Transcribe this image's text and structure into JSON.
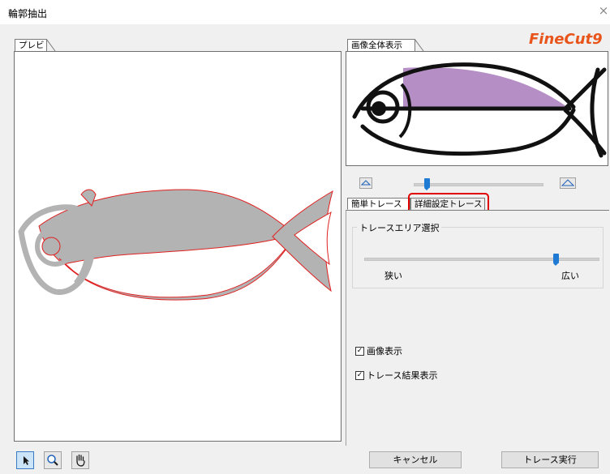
{
  "window": {
    "title": "輪郭抽出",
    "close_glyph": "×"
  },
  "preview": {
    "tab_label": "プレビュー"
  },
  "overview": {
    "tab_label": "画像全体表示",
    "brand": "FineCut9",
    "zoom_level": 0.1
  },
  "trace_tabs": [
    {
      "label": "簡単トレース",
      "active": true
    },
    {
      "label": "詳細設定トレース",
      "active": false,
      "highlighted": true
    }
  ],
  "trace_area": {
    "group_label": "トレースエリア選択",
    "min_label": "狭い",
    "max_label": "広い",
    "value": 0.82
  },
  "options": {
    "show_image_label": "画像表示",
    "show_image_checked": true,
    "show_trace_label": "トレース結果表示",
    "show_trace_checked": true
  },
  "buttons": {
    "cancel": "キャンセル",
    "run": "トレース実行"
  },
  "tools": [
    "select-arrow-icon",
    "magnifier-icon",
    "hand-icon"
  ],
  "colors": {
    "highlight": "#e00000",
    "fill_gray": "#b3b3b3",
    "fill_purple": "#b48ec4",
    "slider": "#1f7ad4",
    "trace_line": "#e02020"
  }
}
